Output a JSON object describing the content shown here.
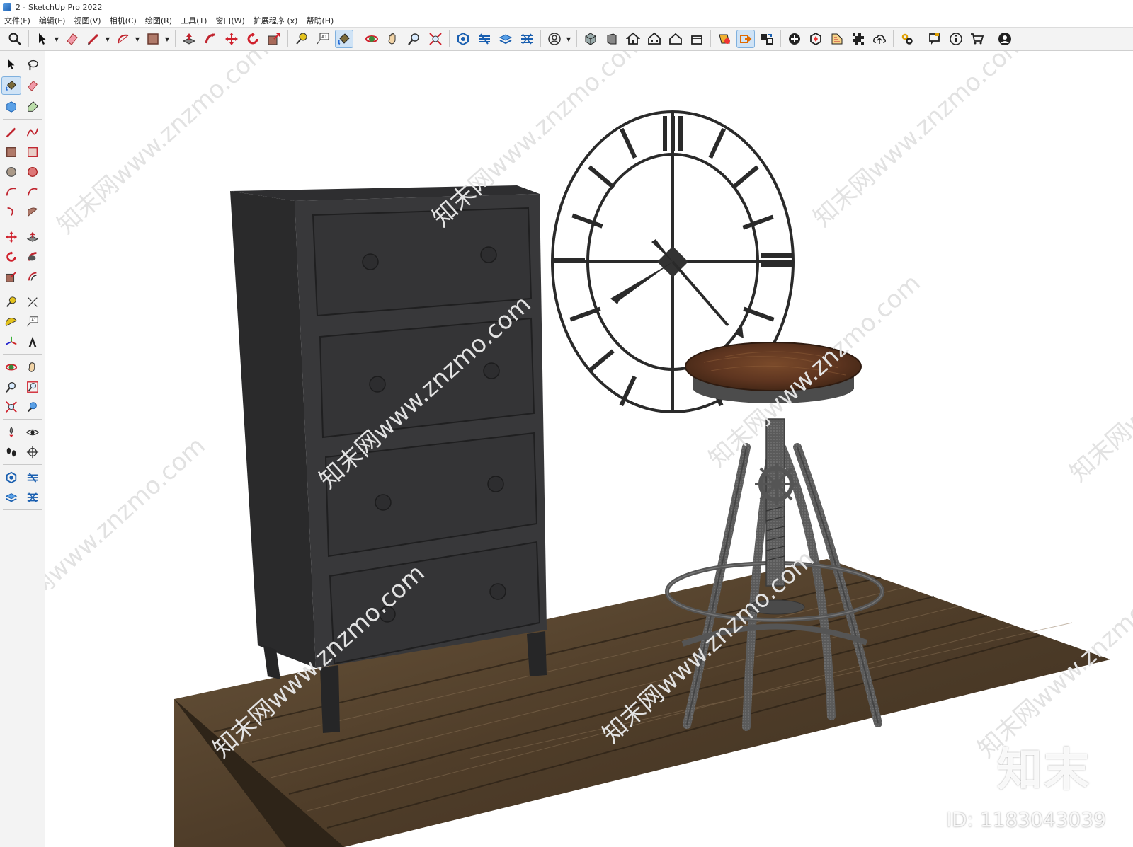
{
  "window": {
    "title": "2 - SketchUp Pro 2022"
  },
  "menu": {
    "file": "文件(F)",
    "edit": "编辑(E)",
    "view": "视图(V)",
    "camera": "相机(C)",
    "draw": "绘图(R)",
    "tools": "工具(T)",
    "window": "窗口(W)",
    "extensions": "扩展程序 (x)",
    "help": "帮助(H)"
  },
  "watermark": {
    "site": "知末网www.znzmo.com",
    "logo": "知末",
    "id": "ID: 1183043039"
  },
  "colors": {
    "toolbar_bg": "#f3f3f3",
    "active_tool_bg": "#cfe3f6",
    "dresser": "#3a3a3c",
    "floor_wood": "#5a4732",
    "stool_seat": "#6b3b22",
    "clock_metal": "#2a2a2a"
  },
  "toolbar": {
    "active_tool": "paint-bucket",
    "icons": [
      "search",
      "select",
      "eraser",
      "pencil-line",
      "arc",
      "rectangle",
      "push-pull",
      "follow-me",
      "move",
      "rotate",
      "scale",
      "tape-measure",
      "text",
      "paint-bucket",
      "orbit",
      "pan",
      "zoom",
      "zoom-extents",
      "warehouse",
      "extension-warehouse",
      "layout",
      "style-builder",
      "account",
      "iso",
      "front",
      "top",
      "back",
      "left",
      "right",
      "section-plane",
      "component",
      "component-replace",
      "add-location",
      "add-classifier",
      "solid-tools",
      "sandbox",
      "geo-location",
      "upload",
      "settings",
      "comment",
      "info",
      "cart",
      "profile"
    ]
  },
  "left_toolbar": {
    "active_tool": "paint-bucket"
  }
}
